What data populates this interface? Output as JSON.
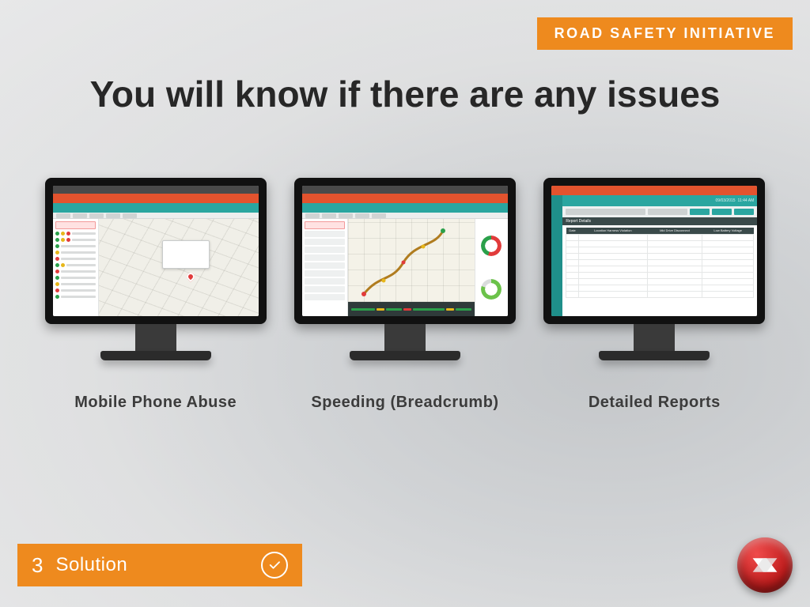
{
  "badge": "ROAD SAFETY INITIATIVE",
  "headline": "You will know if there are any issues",
  "monitors": [
    {
      "caption": "Mobile Phone Abuse"
    },
    {
      "caption": "Speeding (Breadcrumb)"
    },
    {
      "caption": "Detailed Reports"
    }
  ],
  "screen3": {
    "date": "09/03/2015",
    "time": "11:44 AM",
    "title": "Report Details",
    "headers": [
      "Date",
      "Location Harness Violation",
      "Mid Drive Disconnect",
      "Low Battery Voltage"
    ]
  },
  "footer": {
    "number": "3",
    "label": "Solution"
  },
  "colors": {
    "accent": "#ee8a1e",
    "teal": "#2aa6a0",
    "brand": "#e3532e",
    "logoRed": "#c21e1e"
  }
}
